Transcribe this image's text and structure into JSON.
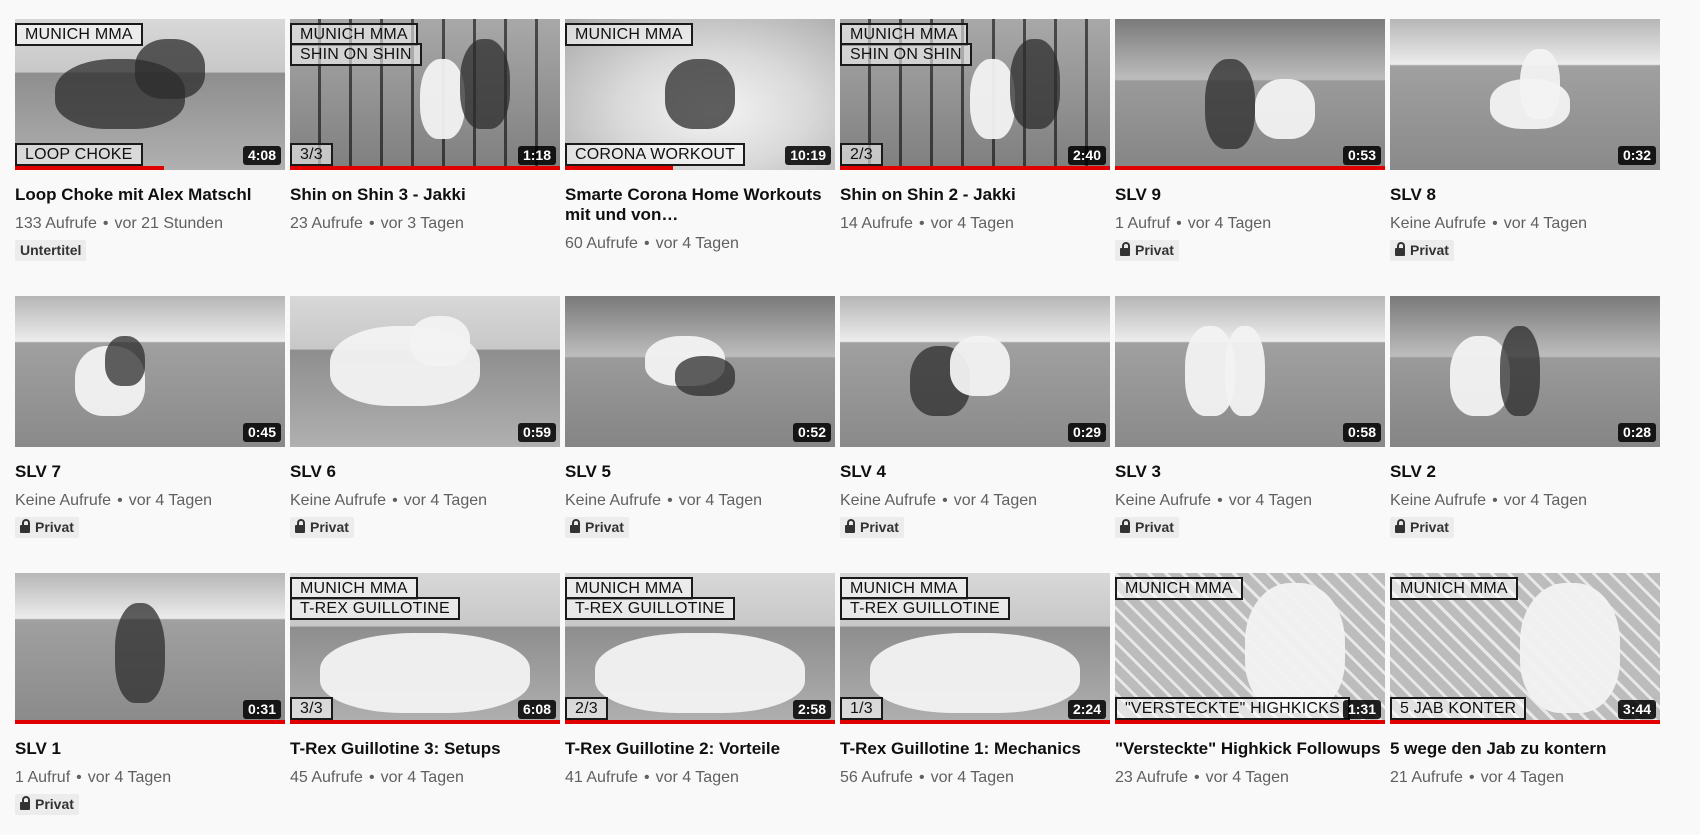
{
  "videos": [
    {
      "title": "Loop Choke mit Alex Matschl",
      "views": "133 Aufrufe",
      "age": "vor 21 Stunden",
      "duration": "4:08",
      "overlay_top": "MUNICH MMA",
      "overlay_top2": "",
      "overlay_bottom": "LOOP CHOKE",
      "badge": "Untertitel",
      "badge_private": false,
      "progress": 0.55
    },
    {
      "title": "Shin on Shin 3 - Jakki",
      "views": "23 Aufrufe",
      "age": "vor 3 Tagen",
      "duration": "1:18",
      "overlay_top": "MUNICH MMA",
      "overlay_top2": "SHIN ON SHIN",
      "overlay_bottom": "3/3",
      "badge": "",
      "badge_private": false,
      "progress": 1.0
    },
    {
      "title": "Smarte Corona Home Workouts mit und von…",
      "views": "60 Aufrufe",
      "age": "vor 4 Tagen",
      "duration": "10:19",
      "overlay_top": "MUNICH MMA",
      "overlay_top2": "",
      "overlay_bottom": "CORONA WORKOUT",
      "badge": "",
      "badge_private": false,
      "progress": 0.4
    },
    {
      "title": "Shin on Shin 2 - Jakki",
      "views": "14 Aufrufe",
      "age": "vor 4 Tagen",
      "duration": "2:40",
      "overlay_top": "MUNICH MMA",
      "overlay_top2": "SHIN ON SHIN",
      "overlay_bottom": "2/3",
      "badge": "",
      "badge_private": false,
      "progress": 1.0
    },
    {
      "title": "SLV 9",
      "views": "1 Aufruf",
      "age": "vor 4 Tagen",
      "duration": "0:53",
      "overlay_top": "",
      "overlay_top2": "",
      "overlay_bottom": "",
      "badge": "Privat",
      "badge_private": true,
      "progress": 1.0
    },
    {
      "title": "SLV 8",
      "views": "Keine Aufrufe",
      "age": "vor 4 Tagen",
      "duration": "0:32",
      "overlay_top": "",
      "overlay_top2": "",
      "overlay_bottom": "",
      "badge": "Privat",
      "badge_private": true,
      "progress": 0
    },
    {
      "title": "SLV 7",
      "views": "Keine Aufrufe",
      "age": "vor 4 Tagen",
      "duration": "0:45",
      "overlay_top": "",
      "overlay_top2": "",
      "overlay_bottom": "",
      "badge": "Privat",
      "badge_private": true,
      "progress": 0
    },
    {
      "title": "SLV 6",
      "views": "Keine Aufrufe",
      "age": "vor 4 Tagen",
      "duration": "0:59",
      "overlay_top": "",
      "overlay_top2": "",
      "overlay_bottom": "",
      "badge": "Privat",
      "badge_private": true,
      "progress": 0
    },
    {
      "title": "SLV 5",
      "views": "Keine Aufrufe",
      "age": "vor 4 Tagen",
      "duration": "0:52",
      "overlay_top": "",
      "overlay_top2": "",
      "overlay_bottom": "",
      "badge": "Privat",
      "badge_private": true,
      "progress": 0
    },
    {
      "title": "SLV 4",
      "views": "Keine Aufrufe",
      "age": "vor 4 Tagen",
      "duration": "0:29",
      "overlay_top": "",
      "overlay_top2": "",
      "overlay_bottom": "",
      "badge": "Privat",
      "badge_private": true,
      "progress": 0
    },
    {
      "title": "SLV 3",
      "views": "Keine Aufrufe",
      "age": "vor 4 Tagen",
      "duration": "0:58",
      "overlay_top": "",
      "overlay_top2": "",
      "overlay_bottom": "",
      "badge": "Privat",
      "badge_private": true,
      "progress": 0
    },
    {
      "title": "SLV 2",
      "views": "Keine Aufrufe",
      "age": "vor 4 Tagen",
      "duration": "0:28",
      "overlay_top": "",
      "overlay_top2": "",
      "overlay_bottom": "",
      "badge": "Privat",
      "badge_private": true,
      "progress": 0
    },
    {
      "title": "SLV 1",
      "views": "1 Aufruf",
      "age": "vor 4 Tagen",
      "duration": "0:31",
      "overlay_top": "",
      "overlay_top2": "",
      "overlay_bottom": "",
      "badge": "Privat",
      "badge_private": true,
      "progress": 1.0
    },
    {
      "title": "T-Rex Guillotine 3: Setups",
      "views": "45 Aufrufe",
      "age": "vor 4 Tagen",
      "duration": "6:08",
      "overlay_top": "MUNICH MMA",
      "overlay_top2": "T-REX GUILLOTINE",
      "overlay_bottom": "3/3",
      "badge": "",
      "badge_private": false,
      "progress": 1.0
    },
    {
      "title": "T-Rex Guillotine 2: Vorteile",
      "views": "41 Aufrufe",
      "age": "vor 4 Tagen",
      "duration": "2:58",
      "overlay_top": "MUNICH MMA",
      "overlay_top2": "T-REX GUILLOTINE",
      "overlay_bottom": "2/3",
      "badge": "",
      "badge_private": false,
      "progress": 1.0
    },
    {
      "title": "T-Rex Guillotine 1: Mechanics",
      "views": "56 Aufrufe",
      "age": "vor 4 Tagen",
      "duration": "2:24",
      "overlay_top": "MUNICH MMA",
      "overlay_top2": "T-REX GUILLOTINE",
      "overlay_bottom": "1/3",
      "badge": "",
      "badge_private": false,
      "progress": 1.0
    },
    {
      "title": "\"Versteckte\" Highkick Followups",
      "views": "23 Aufrufe",
      "age": "vor 4 Tagen",
      "duration": "1:31",
      "overlay_top": "MUNICH MMA",
      "overlay_top2": "",
      "overlay_bottom": "\"VERSTECKTE\" HIGHKICKS",
      "badge": "",
      "badge_private": false,
      "progress": 1.0
    },
    {
      "title": "5 wege den Jab zu kontern",
      "views": "21 Aufrufe",
      "age": "vor 4 Tagen",
      "duration": "3:44",
      "overlay_top": "MUNICH MMA",
      "overlay_top2": "",
      "overlay_bottom": "5 JAB KONTER",
      "badge": "",
      "badge_private": false,
      "progress": 1.0
    }
  ],
  "meta_separator": "•",
  "colors": {
    "progress": "#e00000",
    "background": "#f9f9f9",
    "meta": "#606060"
  },
  "icons": {
    "private_badge": "lock-icon"
  }
}
